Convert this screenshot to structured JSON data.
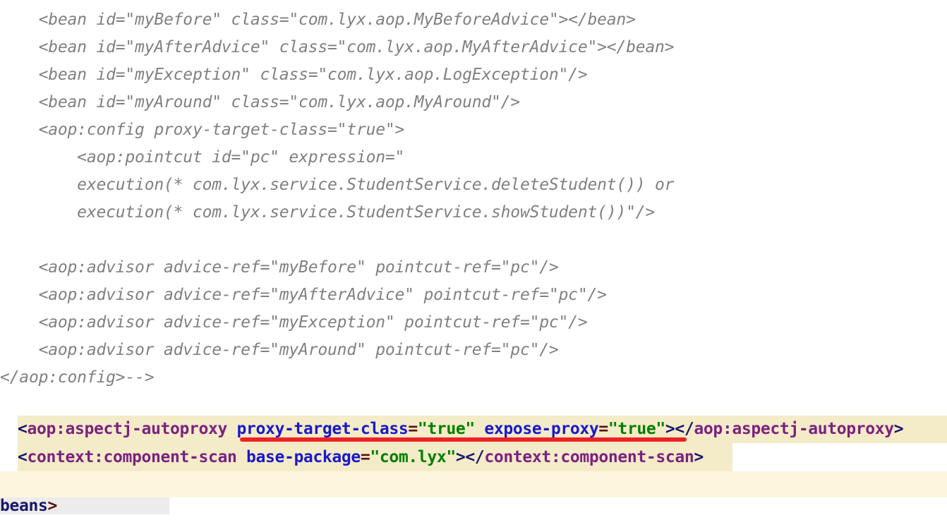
{
  "editor": {
    "language": "xml",
    "theme_background": "#ffffff",
    "comment_color": "#808080",
    "highlight_color_strong": "#f4ecc8",
    "highlight_color_soft": "#fdf6dd",
    "selection_color": "#ececec",
    "annotation_color": "#ee2222",
    "syntax_colors": {
      "punctuation": "#17176b",
      "tag": "#7d2181",
      "attribute": "#1919cc",
      "equals": "#5a1010",
      "quote": "#5a1010",
      "value": "#008000"
    }
  },
  "commented_block": {
    "lines": [
      "    <bean id=\"myBefore\" class=\"com.lyx.aop.MyBeforeAdvice\"></bean>",
      "    <bean id=\"myAfterAdvice\" class=\"com.lyx.aop.MyAfterAdvice\"></bean>",
      "    <bean id=\"myException\" class=\"com.lyx.aop.LogException\"/>",
      "    <bean id=\"myAround\" class=\"com.lyx.aop.MyAround\"/>",
      "    <aop:config proxy-target-class=\"true\">",
      "        <aop:pointcut id=\"pc\" expression=\"",
      "        execution(* com.lyx.service.StudentService.deleteStudent()) or",
      "        execution(* com.lyx.service.StudentService.showStudent())\"/>",
      "",
      "    <aop:advisor advice-ref=\"myBefore\" pointcut-ref=\"pc\"/>",
      "    <aop:advisor advice-ref=\"myAfterAdvice\" pointcut-ref=\"pc\"/>",
      "    <aop:advisor advice-ref=\"myException\" pointcut-ref=\"pc\"/>",
      "    <aop:advisor advice-ref=\"myAround\" pointcut-ref=\"pc\"/>",
      "</aop:config>-->"
    ]
  },
  "active_code": {
    "line1": {
      "open_bracket": "<",
      "tag_open": "aop:aspectj-autoproxy",
      "space1": " ",
      "attr1": "proxy-target-class",
      "eq1": "=",
      "val1": "\"true\"",
      "space2": " ",
      "attr2": "expose-proxy",
      "eq2": "=",
      "val2": "\"true\"",
      "close_bracket": ">",
      "end_open": "</",
      "tag_close": "aop:aspectj-autoproxy",
      "end_bracket": ">"
    },
    "line2": {
      "open_bracket": "<",
      "tag_open": "context:component-scan",
      "space1": " ",
      "attr1": "base-package",
      "eq1": "=",
      "val1": "\"com.lyx\"",
      "close_bracket": ">",
      "end_open": "</",
      "tag_close": "context:component-scan",
      "end_bracket": ">"
    }
  },
  "bottom_line": {
    "text": "beans",
    "bracket": ">"
  }
}
